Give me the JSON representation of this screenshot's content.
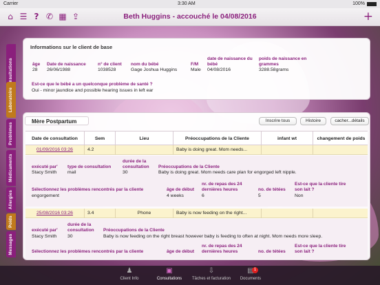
{
  "statusbar": {
    "carrier": "Carrier",
    "time": "3:30 AM",
    "battery": "100%"
  },
  "navbar": {
    "title": "Beth Huggins - accouché le 04/08/2016"
  },
  "side_tabs": [
    "Consultations",
    "Laboratoire",
    "Problèmes",
    "Médicaments",
    "Allergies",
    "Poids",
    "Messages"
  ],
  "client_info": {
    "header": "Informations sur le client de base",
    "fields": [
      {
        "label": "âge",
        "value": "28"
      },
      {
        "label": "Date de naissance",
        "value": "26/06/1988"
      },
      {
        "label": "n° de client",
        "value": "1038528"
      },
      {
        "label": "nom du bébé",
        "value": "Gage Joshua Huggins"
      },
      {
        "label": "F/M",
        "value": "Male"
      },
      {
        "label": "date de naissance du bébé",
        "value": "04/08/2016"
      },
      {
        "label": "poids de naissance en grammes",
        "value": "3288.58grams"
      }
    ],
    "question": "Est-ce que le bébé a un quelconque problème de santé ?",
    "answer": "Oui - minor jaundice and possible hearing issues in left ear"
  },
  "mere": {
    "title": "Mère Postpartum",
    "buttons": {
      "register_all": "Inscrire tous",
      "history": "Histoire",
      "hide_details": "cacher...détails"
    },
    "columns": [
      "Date de consultation",
      "Sem",
      "Lieu",
      "Préoccupations de la Cliente",
      "infant wt",
      "changement de poids"
    ],
    "rows": [
      {
        "date": "01/09/2016 03:26",
        "sem": "4.2",
        "lieu": "",
        "preoccupation": "Baby is doing great. Mom needs...",
        "infant_wt": "",
        "change": "",
        "detail": {
          "executed_by_label": "exécuté par'",
          "executed_by": "Stacy Smith",
          "type_label": "type de consultation",
          "type": "mail",
          "duration_label": "durée de la consultation",
          "duration": "30",
          "preocc_label": "Préoccupations de la Cliente",
          "preocc": "Baby is doing great. Mom needs care plan for engorged left nipple.",
          "problems_label": "Sélectionnez les problèmes rencontrés par la cliente",
          "problems": "engorgement",
          "age_label": "âge de début",
          "age": "4 weeks",
          "meals_label": "nr. de repas des 24 dernières heures",
          "meals": "6",
          "teats_label": "no. de tétées",
          "teats": "5",
          "milk_label": "Est-ce que la cliente tire son lait ?",
          "milk": "Non"
        }
      },
      {
        "date": "25/08/2016 03:26",
        "sem": "3.4",
        "lieu": "Phone",
        "preoccupation": "Baby is now feeding on the right...",
        "infant_wt": "",
        "change": "",
        "detail": {
          "executed_by_label": "exécuté par'",
          "executed_by": "Stacy Smith",
          "duration_label": "durée de la consultation",
          "duration": "30",
          "preocc_label": "Préoccupations de la Cliente",
          "preocc": "Baby is now feeding on the right breast however baby is feeding to often at night.  Mom needs more sleep.",
          "problems_label": "Sélectionnez les problèmes rencontrés par la cliente",
          "age_label": "âge de début",
          "meals_label": "nr. de repas des 24 dernières heures",
          "teats_label": "no. de tétées",
          "milk_label": "Est-ce que la cliente tire son lait ?"
        }
      }
    ]
  },
  "tabbar": {
    "items": [
      {
        "label": "Client Info",
        "icon": "person-icon"
      },
      {
        "label": "Consultations",
        "icon": "briefcase-icon"
      },
      {
        "label": "Tâches et facturation",
        "icon": "download-icon"
      },
      {
        "label": "Documents",
        "icon": "document-icon",
        "badge": "1"
      }
    ]
  },
  "colors": {
    "accent": "#8a1f7c"
  }
}
